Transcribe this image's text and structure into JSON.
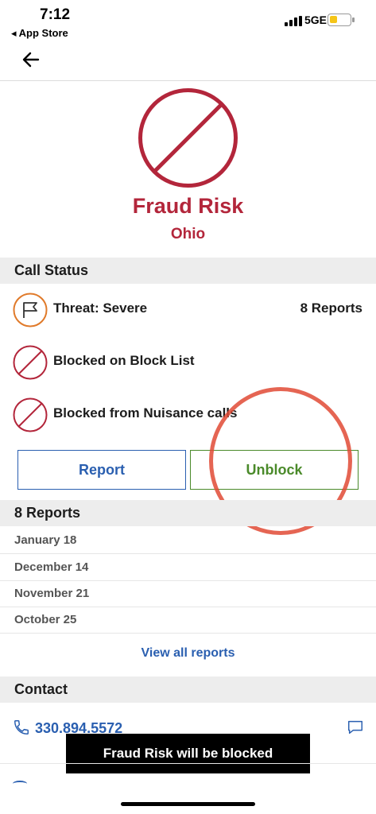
{
  "status_bar": {
    "time": "7:12",
    "back_app": "◂ App Store",
    "network": "5GE"
  },
  "hero": {
    "title": "Fraud Risk",
    "subtitle": "Ohio",
    "icon": "blocked-icon",
    "color": "#b3263b"
  },
  "call_status": {
    "header": "Call Status",
    "rows": [
      {
        "icon": "flag-icon",
        "label": "Threat: Severe",
        "count": "8 Reports"
      },
      {
        "icon": "blocked-icon",
        "label": "Blocked on Block List"
      },
      {
        "icon": "blocked-icon",
        "label": "Blocked from Nuisance calls"
      }
    ]
  },
  "actions": {
    "report_label": "Report",
    "unblock_label": "Unblock"
  },
  "reports": {
    "header": "8 Reports",
    "dates": [
      "January 18",
      "December 14",
      "November 21",
      "October 25"
    ],
    "view_all": "View all reports"
  },
  "contact": {
    "header": "Contact",
    "phone": "330.894.5572"
  },
  "toast": "Fraud Risk will be blocked",
  "colors": {
    "brand_red": "#b3263b",
    "link_blue": "#2a5fb0",
    "unblock_green": "#4a8a2a",
    "annotation": "#e04a35"
  }
}
